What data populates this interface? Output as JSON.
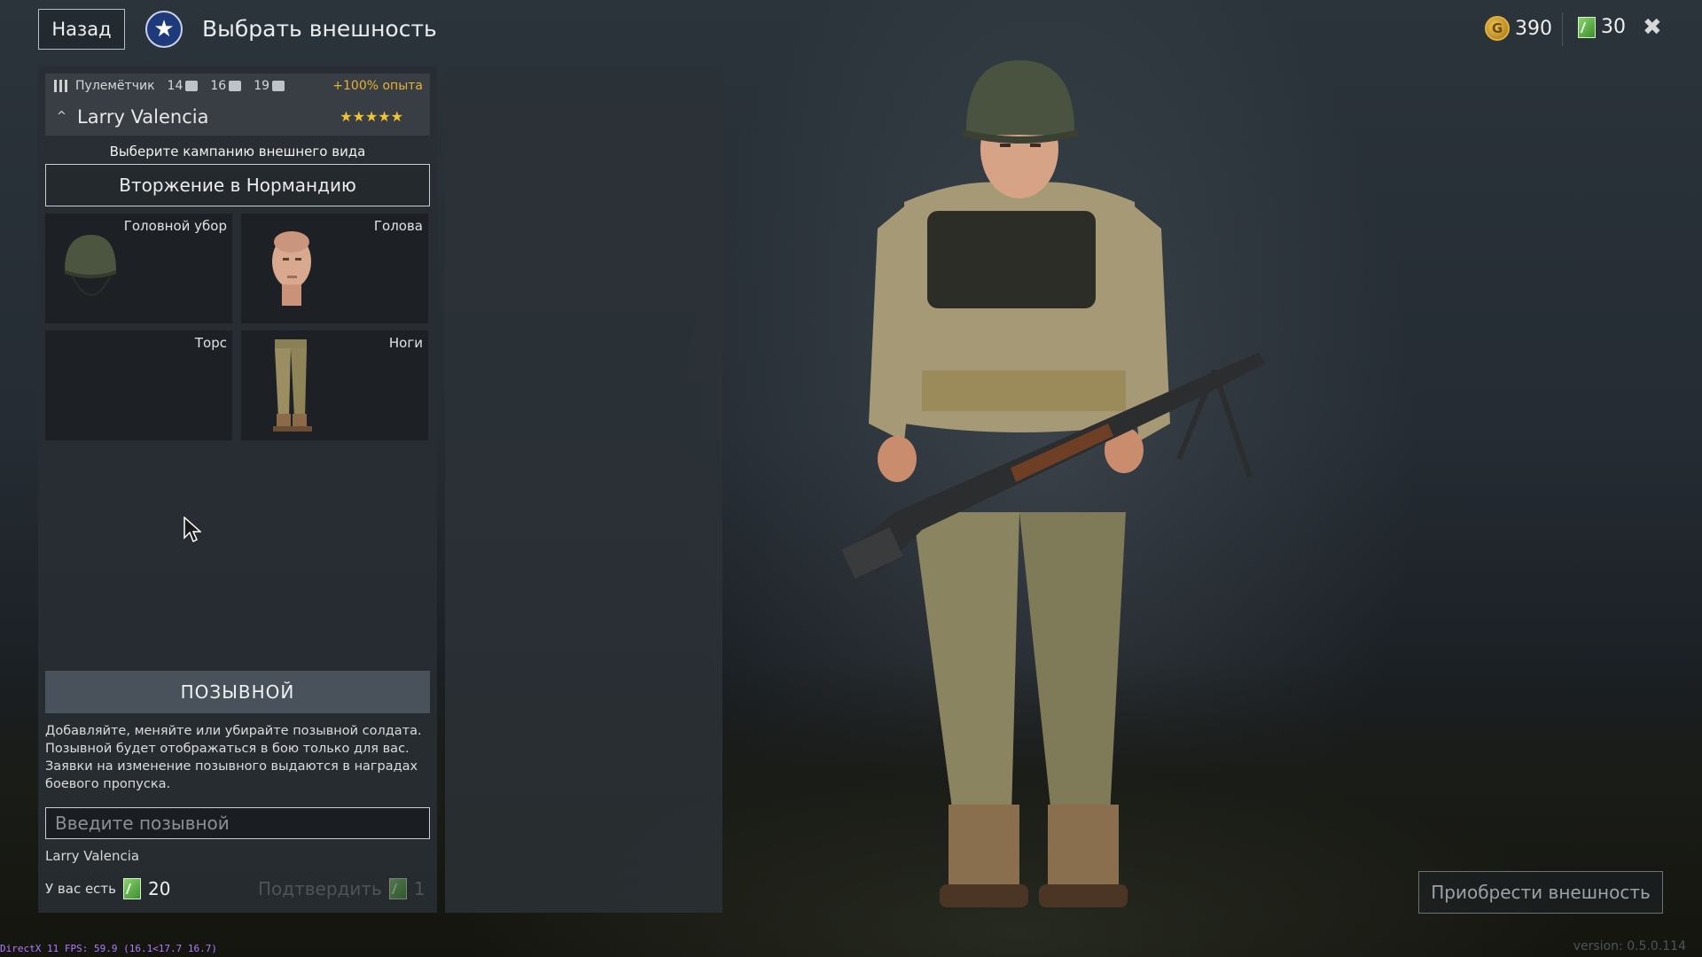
{
  "header": {
    "back_label": "Назад",
    "title": "Выбрать внешность",
    "gold_amount": "390",
    "tickets_amount": "30"
  },
  "soldier": {
    "class_name": "Пулемётчик",
    "stat1": "14",
    "stat2": "16",
    "stat3": "19",
    "xp_bonus": "+100% опыта",
    "name": "Larry Valencia",
    "stars": "★★★★★"
  },
  "campaign": {
    "caption": "Выберите кампанию внешнего вида",
    "selected": "Вторжение в Нормандию"
  },
  "slots": [
    {
      "label": "Головной убор",
      "icon": "helmet-icon"
    },
    {
      "label": "Голова",
      "icon": "head-icon"
    },
    {
      "label": "Торс",
      "icon": "torso-icon"
    },
    {
      "label": "Ноги",
      "icon": "legs-icon"
    }
  ],
  "callsign": {
    "header": "ПОЗЫВНОЙ",
    "desc1": "Добавляйте, меняйте или убирайте позывной солдата.",
    "desc2": "Позывной будет отображаться в бою только для вас.",
    "desc3": "Заявки на изменение позывного выдаются в наградах",
    "desc4": "боевого пропуска.",
    "placeholder": "Введите позывной",
    "current": "Larry Valencia",
    "balance_label": "У вас есть",
    "balance_value": "20",
    "confirm_label": "Подтвердить",
    "confirm_cost": "1"
  },
  "buy_label": "Приобрести внешность",
  "footer": {
    "fps": "DirectX 11 FPS: 59.9 (16.1<17.7 16.7)",
    "version": "version: 0.5.0.114"
  },
  "colors": {
    "accent_gold": "#e7b232",
    "ticket_green": "#6cc04a"
  }
}
